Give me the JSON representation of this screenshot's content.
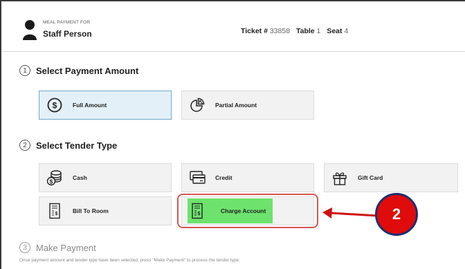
{
  "header": {
    "meal_label": "MEAL PAYMENT FOR",
    "person_name": "Staff Person",
    "ticket_label": "Ticket #",
    "ticket_value": "33858",
    "table_label": "Table",
    "table_value": "1",
    "seat_label": "Seat",
    "seat_value": "4"
  },
  "step1": {
    "number": "1",
    "title": "Select Payment Amount"
  },
  "payment_amount": {
    "full": "Full Amount",
    "partial": "Partial Amount",
    "selected": "Full Amount"
  },
  "step2": {
    "number": "2",
    "title": "Select Tender Type"
  },
  "tender": {
    "cash": "Cash",
    "credit": "Credit",
    "gift_card": "Gift Card",
    "bill_to_room": "Bill To Room",
    "charge_account": "Charge Account",
    "selected": "Charge Account"
  },
  "step3": {
    "number": "3",
    "title": "Make Payment"
  },
  "footnote": "Once payment amount and tender type have been selected, press \"Make Payment\" to process the tender type.",
  "callout": {
    "number": "2"
  },
  "colors": {
    "selected_tile_bg": "#e3f0f8",
    "selected_tile_border": "#6ea8cc",
    "highlight_green": "#6de36d",
    "annotation_red": "#e00b0b",
    "annotation_border_navy": "#1e2f6e"
  }
}
